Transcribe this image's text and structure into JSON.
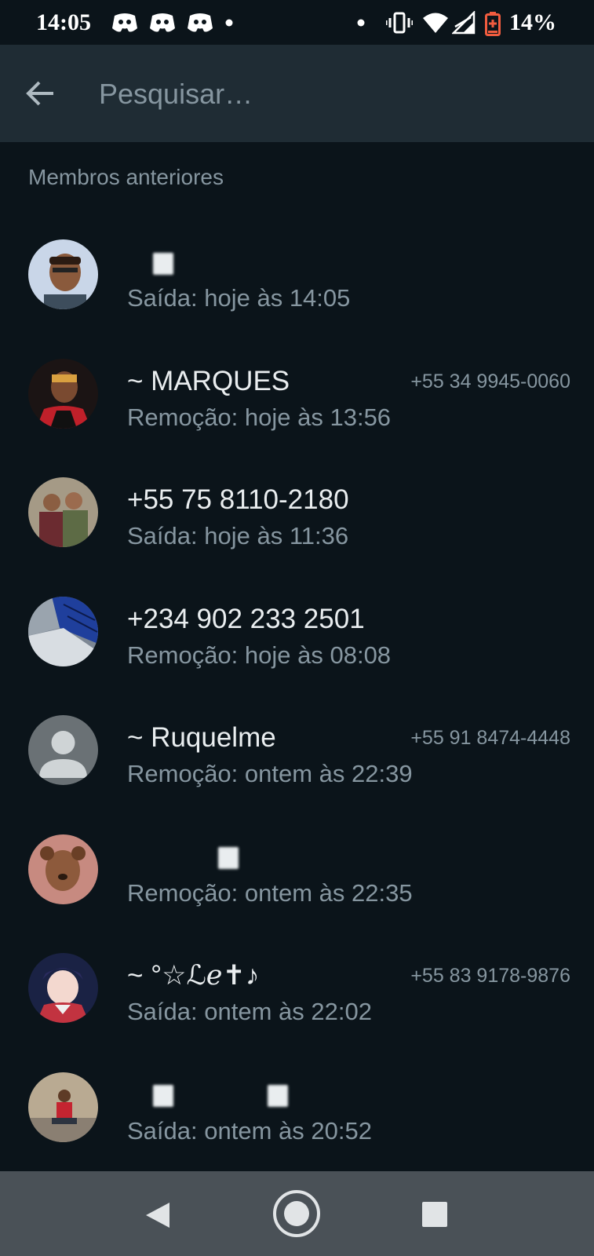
{
  "status_bar": {
    "time": "14:05",
    "battery": "14%",
    "icons": [
      "discord-icon",
      "discord-icon",
      "discord-icon",
      "dot-icon",
      "dot-icon",
      "vibrate-icon",
      "wifi-icon",
      "signal-icon",
      "battery-icon"
    ]
  },
  "search": {
    "placeholder": "Pesquisar…"
  },
  "section": {
    "title": "Membros anteriores"
  },
  "members": [
    {
      "name": "",
      "phone": "",
      "status": "Saída: hoje às 14:05",
      "redacted": true
    },
    {
      "name": "~ MARQUES",
      "phone": "+55 34 9945-0060",
      "status": "Remoção: hoje às 13:56"
    },
    {
      "name": "+55 75 8110-2180",
      "phone": "",
      "status": "Saída: hoje às 11:36"
    },
    {
      "name": "+234 902 233 2501",
      "phone": "",
      "status": "Remoção: hoje às 08:08"
    },
    {
      "name": "~ Ruquelme",
      "phone": "+55 91 8474-4448",
      "status": "Remoção: ontem às 22:39"
    },
    {
      "name": "",
      "phone": "",
      "status": "Remoção: ontem às 22:35",
      "redacted": true
    },
    {
      "name": "~ °☆ℒℯ✝♪",
      "phone": "+55 83 9178-9876",
      "status": "Saída: ontem às 22:02"
    },
    {
      "name": "",
      "phone": "",
      "status": "Saída: ontem às 20:52",
      "redacted": true
    }
  ],
  "colors": {
    "background": "#0b141a",
    "toolbar": "#1f2c34",
    "secondary_text": "#8696a0",
    "primary_text": "#e9edef",
    "battery_low": "#f15c3f"
  }
}
